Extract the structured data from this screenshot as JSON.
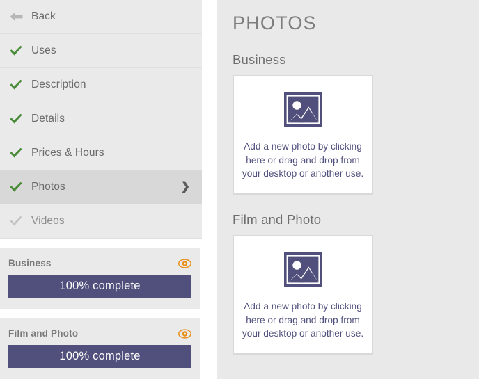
{
  "sidebar": {
    "nav_items": [
      {
        "label": "Back",
        "icon": "back-arrow-icon",
        "state": "back",
        "active": false,
        "chevron": false
      },
      {
        "label": "Uses",
        "icon": "check-icon",
        "state": "complete",
        "active": false,
        "chevron": false
      },
      {
        "label": "Description",
        "icon": "check-icon",
        "state": "complete",
        "active": false,
        "chevron": false
      },
      {
        "label": "Details",
        "icon": "check-icon",
        "state": "complete",
        "active": false,
        "chevron": false
      },
      {
        "label": "Prices & Hours",
        "icon": "check-icon",
        "state": "complete",
        "active": false,
        "chevron": false
      },
      {
        "label": "Photos",
        "icon": "check-icon",
        "state": "complete",
        "active": true,
        "chevron": true
      },
      {
        "label": "Videos",
        "icon": "check-icon",
        "state": "incomplete",
        "active": false,
        "chevron": false
      }
    ],
    "progress_cards": [
      {
        "title": "Business",
        "percent": 100,
        "progress_label": "100% complete",
        "eye_icon": "eye-icon"
      },
      {
        "title": "Film and Photo",
        "percent": 100,
        "progress_label": "100% complete",
        "eye_icon": "eye-icon"
      }
    ]
  },
  "main": {
    "title": "PHOTOS",
    "sections": [
      {
        "title": "Business",
        "dropzone_text": "Add a new photo by clicking here or drag and drop from your desktop or another use.",
        "dropzone_icon": "photo-placeholder-icon"
      },
      {
        "title": "Film and Photo",
        "dropzone_text": "Add a new photo by clicking here or drag and drop from your desktop or another use.",
        "dropzone_icon": "photo-placeholder-icon"
      }
    ]
  },
  "colors": {
    "accent_purple": "#51507d",
    "check_green": "#4a8b3a",
    "check_grey": "#c5c5c5",
    "eye_orange": "#e8901c",
    "panel_grey": "#e9e9e9",
    "sidebar_grey": "#eaeaea",
    "active_grey": "#d8d8d8"
  }
}
